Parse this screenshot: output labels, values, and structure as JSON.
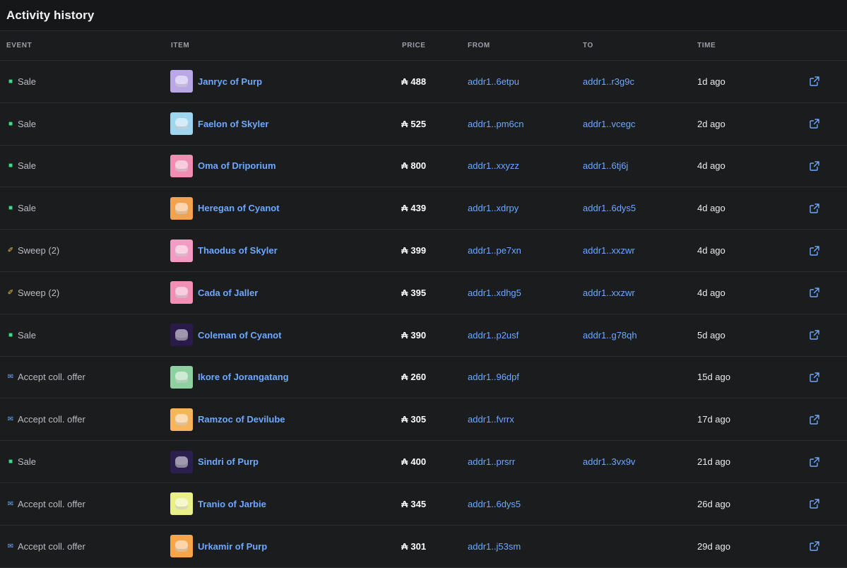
{
  "title": "Activity history",
  "columns": {
    "event": "EVENT",
    "item": "ITEM",
    "price": "PRICE",
    "from": "FROM",
    "to": "TO",
    "time": "TIME"
  },
  "currency_symbol": "₳",
  "rows": [
    {
      "event": "Sale",
      "event_icon": "cart-icon",
      "item": "Janryc of Purp",
      "thumb_color": "#b9a7e8",
      "price": "488",
      "from": "addr1..6etpu",
      "to": "addr1..r3g9c",
      "time": "1d ago"
    },
    {
      "event": "Sale",
      "event_icon": "cart-icon",
      "item": "Faelon of Skyler",
      "thumb_color": "#9fd6ef",
      "price": "525",
      "from": "addr1..pm6cn",
      "to": "addr1..vcegc",
      "time": "2d ago"
    },
    {
      "event": "Sale",
      "event_icon": "cart-icon",
      "item": "Oma of Driporium",
      "thumb_color": "#f08db3",
      "price": "800",
      "from": "addr1..xxyzz",
      "to": "addr1..6tj6j",
      "time": "4d ago"
    },
    {
      "event": "Sale",
      "event_icon": "cart-icon",
      "item": "Heregan of Cyanot",
      "thumb_color": "#f3a24f",
      "price": "439",
      "from": "addr1..xdrpy",
      "to": "addr1..6dys5",
      "time": "4d ago"
    },
    {
      "event": "Sweep (2)",
      "event_icon": "broom-icon",
      "item": "Thaodus of Skyler",
      "thumb_color": "#f39bc2",
      "price": "399",
      "from": "addr1..pe7xn",
      "to": "addr1..xxzwr",
      "time": "4d ago"
    },
    {
      "event": "Sweep (2)",
      "event_icon": "broom-icon",
      "item": "Cada of Jaller",
      "thumb_color": "#f28fb5",
      "price": "395",
      "from": "addr1..xdhg5",
      "to": "addr1..xxzwr",
      "time": "4d ago"
    },
    {
      "event": "Sale",
      "event_icon": "cart-icon",
      "item": "Coleman of Cyanot",
      "thumb_color": "#2a1a4a",
      "price": "390",
      "from": "addr1..p2usf",
      "to": "addr1..g78qh",
      "time": "5d ago"
    },
    {
      "event": "Accept coll. offer",
      "event_icon": "mail-icon",
      "item": "Ikore of Jorangatang",
      "thumb_color": "#8fd0a0",
      "price": "260",
      "from": "addr1..96dpf",
      "to": "",
      "time": "15d ago"
    },
    {
      "event": "Accept coll. offer",
      "event_icon": "mail-icon",
      "item": "Ramzoc of Devilube",
      "thumb_color": "#f7b45a",
      "price": "305",
      "from": "addr1..fvrrx",
      "to": "",
      "time": "17d ago"
    },
    {
      "event": "Sale",
      "event_icon": "cart-icon",
      "item": "Sindri of Purp",
      "thumb_color": "#2b1f4f",
      "price": "400",
      "from": "addr1..prsrr",
      "to": "addr1..3vx9v",
      "time": "21d ago"
    },
    {
      "event": "Accept coll. offer",
      "event_icon": "mail-icon",
      "item": "Tranio of Jarbie",
      "thumb_color": "#e9f08a",
      "price": "345",
      "from": "addr1..6dys5",
      "to": "",
      "time": "26d ago"
    },
    {
      "event": "Accept coll. offer",
      "event_icon": "mail-icon",
      "item": "Urkamir of Purp",
      "thumb_color": "#f6a548",
      "price": "301",
      "from": "addr1..j53sm",
      "to": "",
      "time": "29d ago"
    }
  ],
  "colors": {
    "background": "#1a1c1e",
    "link": "#6ea8ff",
    "sale_icon": "#3ddc84",
    "sweep_icon": "#f2c744",
    "offer_icon": "#6ea8ff"
  }
}
